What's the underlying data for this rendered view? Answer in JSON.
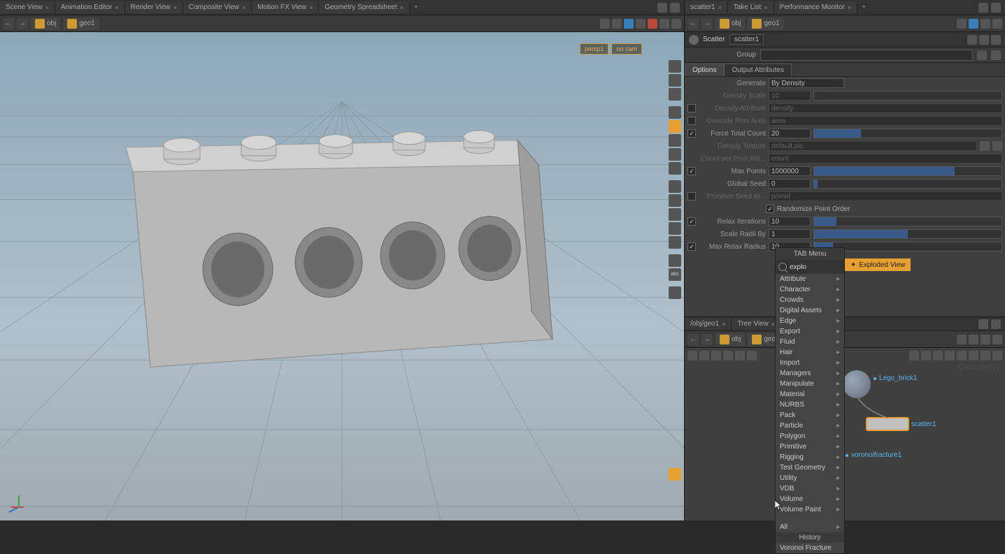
{
  "left": {
    "tabs": [
      "Scene View",
      "Animation Editor",
      "Render View",
      "Composite View",
      "Motion FX View",
      "Geometry Spreadsheet"
    ],
    "path": {
      "root": "obj",
      "node": "geo1"
    },
    "viewport": {
      "camera": "persp1",
      "nocam": "no cam"
    }
  },
  "right": {
    "top_tabs": [
      "scatter1",
      "Take List",
      "Performance Monitor"
    ],
    "path": {
      "root": "obj",
      "node": "geo1"
    },
    "node": {
      "type": "Scatter",
      "name": "scatter1"
    },
    "group_label": "Group",
    "param_tabs": [
      "Options",
      "Output Attributes"
    ],
    "params": {
      "generate_label": "Generate",
      "generate_value": "By Density",
      "density_scale_label": "Density Scale",
      "density_scale_value": "10",
      "density_attr_label": "Density Attribute",
      "density_attr_value": "density",
      "override_prim_label": "Override Prim Area",
      "override_prim_value": "area",
      "force_total_label": "Force Total Count",
      "force_total_value": "20",
      "density_texture_label": "Density Texture",
      "density_texture_value": "default.pic",
      "count_per_prim_label": "Count per Prim Attr...",
      "count_per_prim_value": "count",
      "max_points_label": "Max Points",
      "max_points_value": "1000000",
      "global_seed_label": "Global Seed",
      "global_seed_value": "0",
      "prim_seed_label": "Primitive Seed At...",
      "prim_seed_value": "primid",
      "randomize_label": "Randomize Point Order",
      "relax_iter_label": "Relax Iterations",
      "relax_iter_value": "10",
      "scale_radii_label": "Scale Radii By",
      "scale_radii_value": "1",
      "max_relax_label": "Max Relax Radius",
      "max_relax_value": "10"
    }
  },
  "tab_menu": {
    "title": "TAB Menu",
    "search": "explo",
    "result": "Exploded View",
    "items": [
      "Attribute",
      "Character",
      "Crowds",
      "Digital Assets",
      "Edge",
      "Export",
      "Fluid",
      "Hair",
      "Import",
      "Managers",
      "Manipulate",
      "Material",
      "NURBS",
      "Pack",
      "Particle",
      "Polygon",
      "Primitive",
      "Rigging",
      "Test Geometry",
      "Utility",
      "VDB",
      "Volume",
      "Volume Paint"
    ],
    "all": "All",
    "history": "History",
    "history_item": "Voronoi Fracture"
  },
  "network": {
    "tabs": [
      "/obj/geo1",
      "Tree View"
    ],
    "path": {
      "root": "obj",
      "node": "geo1"
    },
    "nodes": {
      "lego": "Lego_brick1",
      "scatter": "scatter1",
      "voronoi": "voronoifracture1"
    },
    "watermark": "Geometry"
  }
}
